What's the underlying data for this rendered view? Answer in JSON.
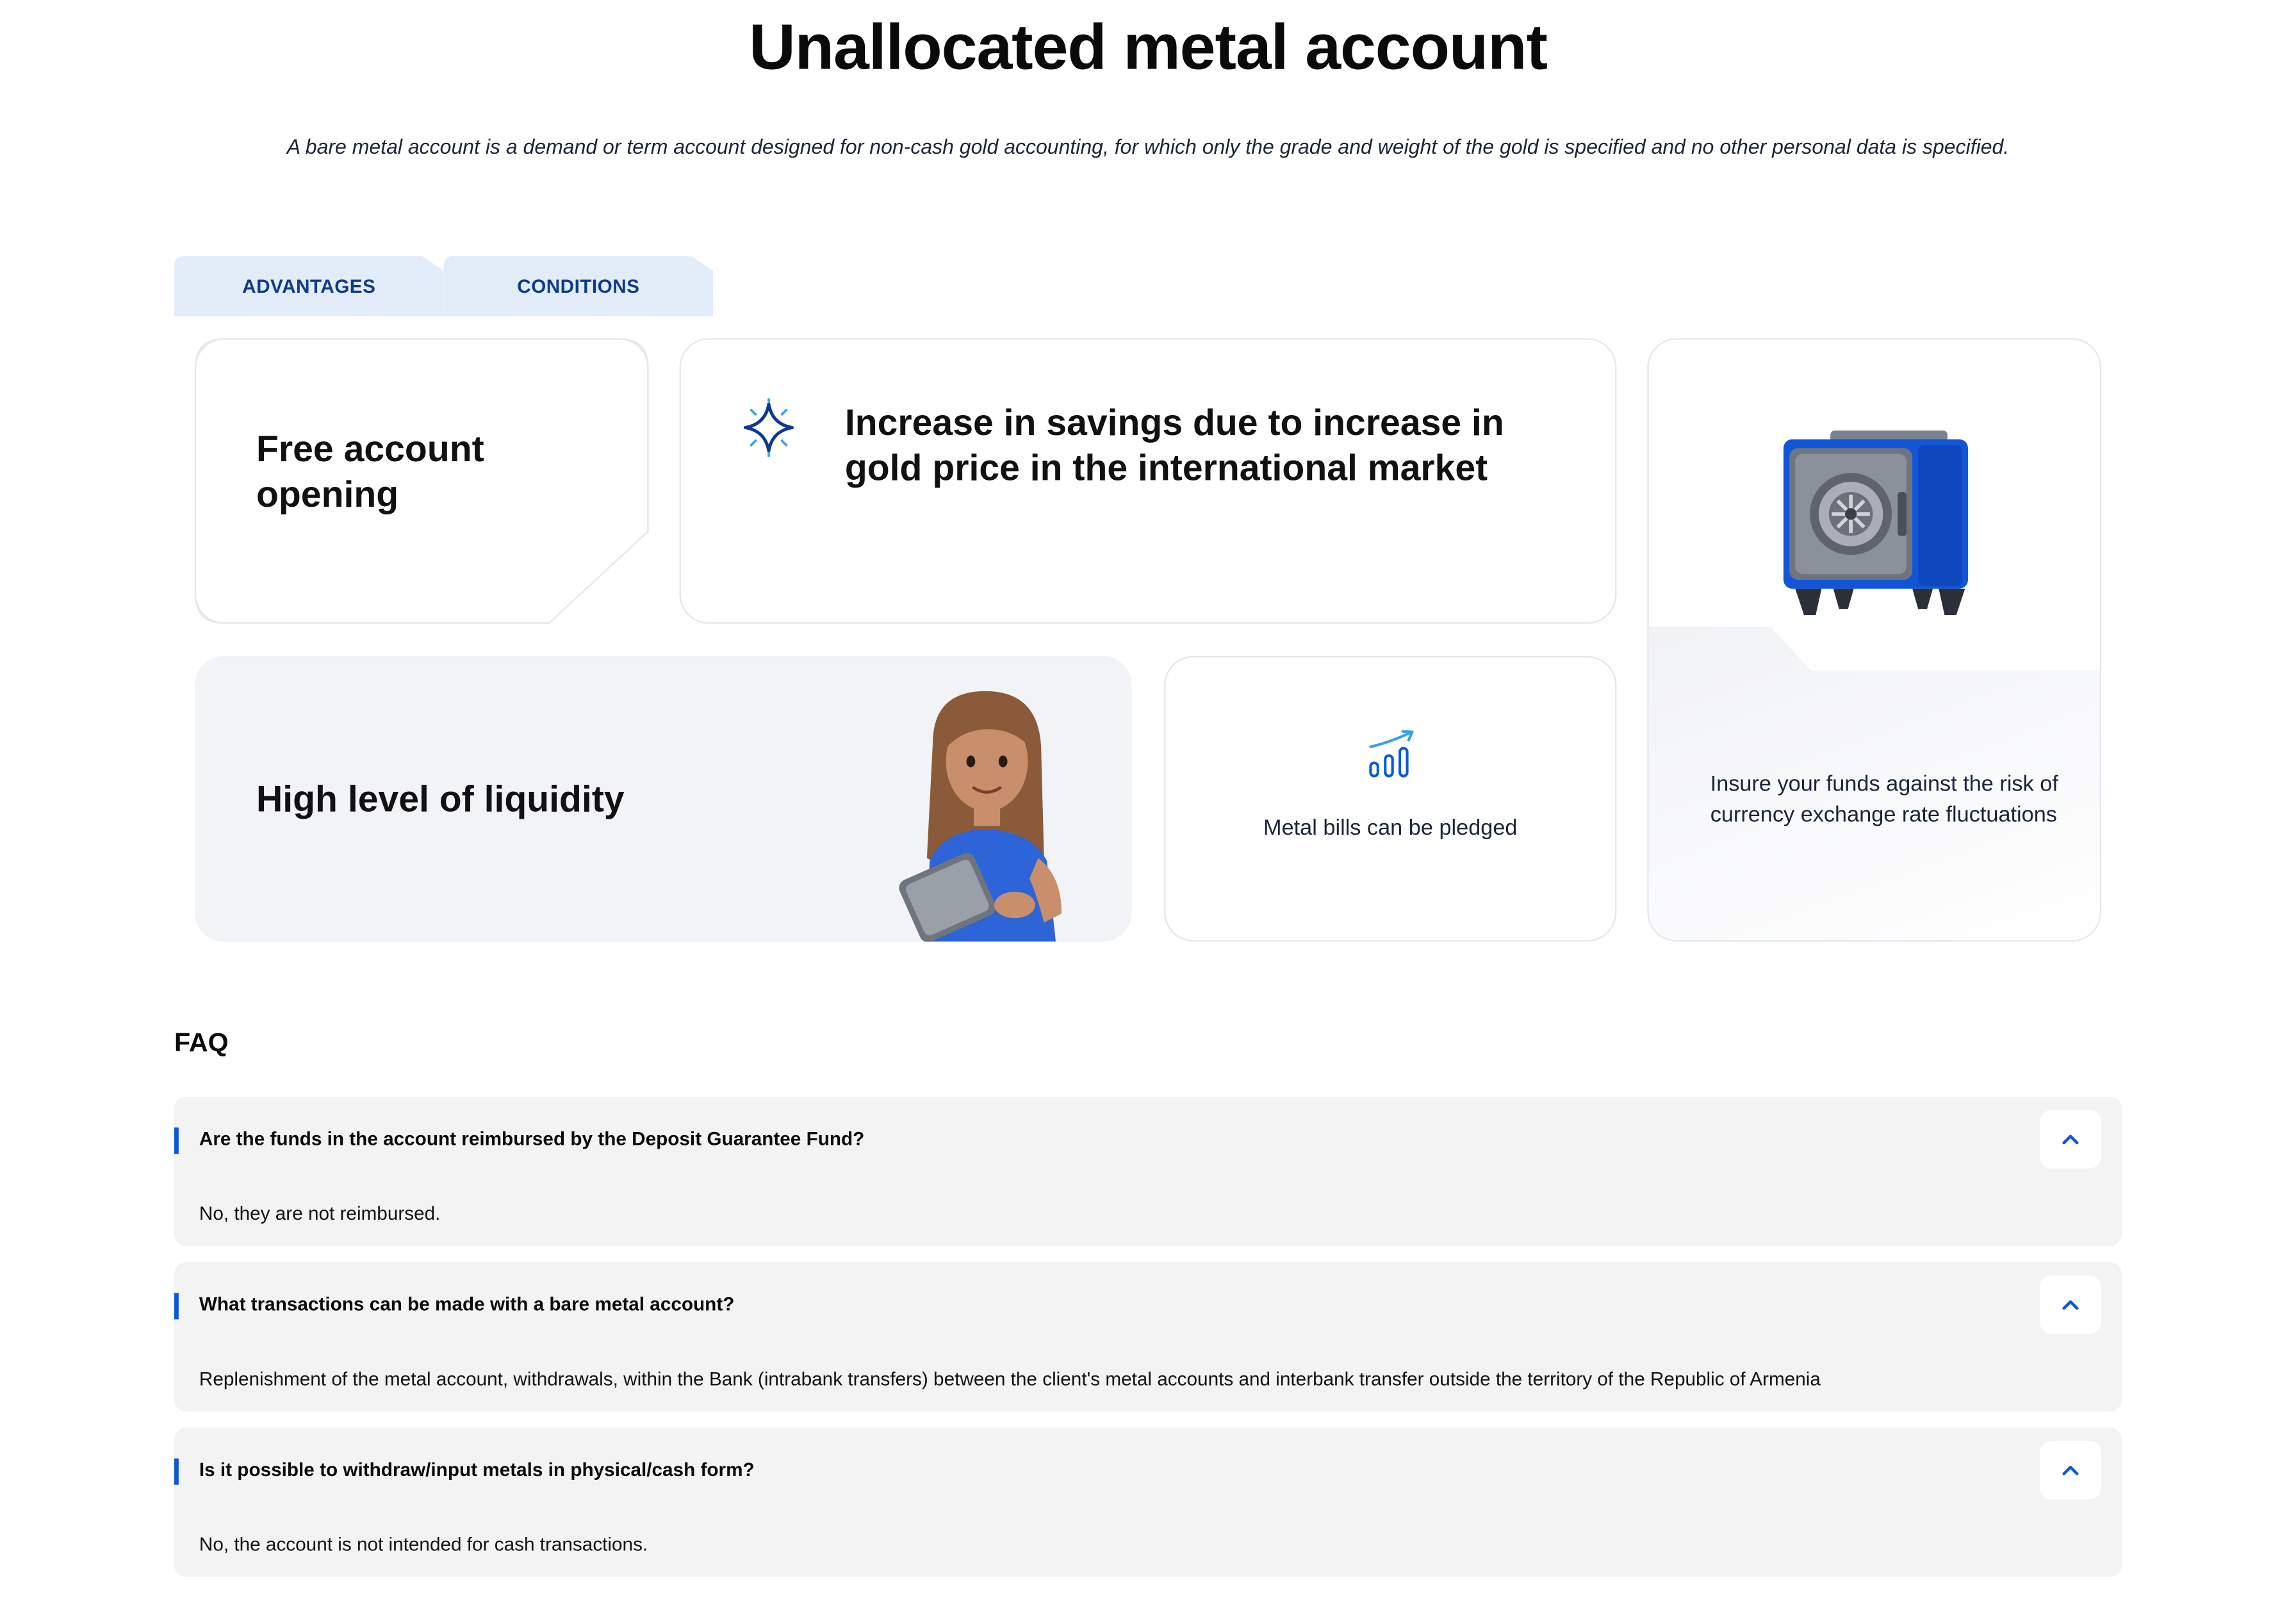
{
  "header": {
    "title": "Unallocated metal account",
    "subtitle": "A bare metal account is a demand or term account designed for non-cash gold accounting, for which only the grade and weight of the gold is specified and no other personal data is specified."
  },
  "tabs": [
    {
      "label": "ADVANTAGES"
    },
    {
      "label": "CONDITIONS"
    }
  ],
  "cards": {
    "free_opening": "Free account opening",
    "savings_increase": "Increase in savings due to increase in gold price in the international market",
    "insure": "Insure your funds against the risk of currency exchange rate fluctuations",
    "liquidity": "High level of liquidity",
    "pledge": "Metal bills can be pledged"
  },
  "faq": {
    "title": "FAQ",
    "items": [
      {
        "question": "Are the funds in the account reimbursed by the Deposit Guarantee Fund?",
        "answer": "No, they are not reimbursed."
      },
      {
        "question": "What transactions can be made with a bare metal account?",
        "answer": "Replenishment of the metal account, withdrawals, within the Bank (intrabank transfers) between the client's metal accounts and interbank transfer outside the territory of the Republic of Armenia"
      },
      {
        "question": "Is it possible to withdraw/input metals in physical/cash form?",
        "answer": "No, the account is not intended for cash transactions."
      }
    ]
  },
  "icons": {
    "sparkle": "sparkle-icon",
    "growth_chart": "growth-chart-icon",
    "safe": "safe-illustration",
    "person": "person-with-tablet-illustration",
    "chevron": "chevron-up-icon"
  },
  "colors": {
    "accent": "#0a5ad6",
    "tab_bg": "#e3ecf9",
    "tab_text": "#0d3b8c",
    "safe_blue": "#1155d9"
  }
}
